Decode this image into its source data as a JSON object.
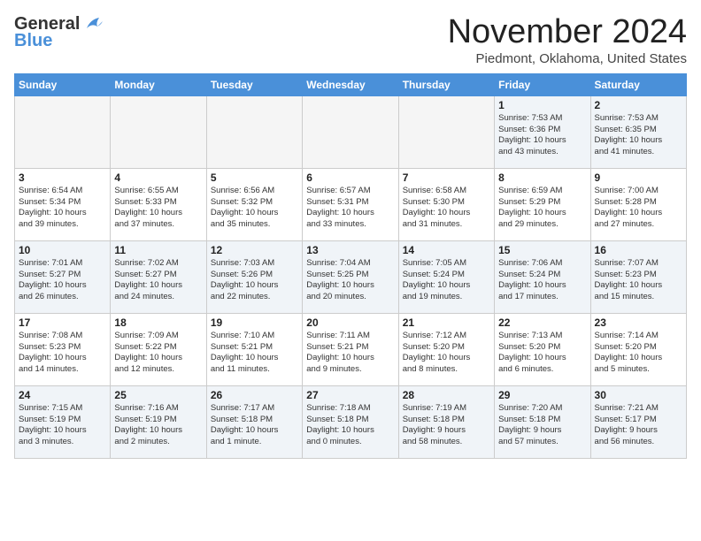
{
  "header": {
    "logo_line1": "General",
    "logo_line2": "Blue",
    "month": "November 2024",
    "location": "Piedmont, Oklahoma, United States"
  },
  "weekdays": [
    "Sunday",
    "Monday",
    "Tuesday",
    "Wednesday",
    "Thursday",
    "Friday",
    "Saturday"
  ],
  "weeks": [
    [
      {
        "day": "",
        "info": ""
      },
      {
        "day": "",
        "info": ""
      },
      {
        "day": "",
        "info": ""
      },
      {
        "day": "",
        "info": ""
      },
      {
        "day": "",
        "info": ""
      },
      {
        "day": "1",
        "info": "Sunrise: 7:53 AM\nSunset: 6:36 PM\nDaylight: 10 hours\nand 43 minutes."
      },
      {
        "day": "2",
        "info": "Sunrise: 7:53 AM\nSunset: 6:35 PM\nDaylight: 10 hours\nand 41 minutes."
      }
    ],
    [
      {
        "day": "3",
        "info": "Sunrise: 6:54 AM\nSunset: 5:34 PM\nDaylight: 10 hours\nand 39 minutes."
      },
      {
        "day": "4",
        "info": "Sunrise: 6:55 AM\nSunset: 5:33 PM\nDaylight: 10 hours\nand 37 minutes."
      },
      {
        "day": "5",
        "info": "Sunrise: 6:56 AM\nSunset: 5:32 PM\nDaylight: 10 hours\nand 35 minutes."
      },
      {
        "day": "6",
        "info": "Sunrise: 6:57 AM\nSunset: 5:31 PM\nDaylight: 10 hours\nand 33 minutes."
      },
      {
        "day": "7",
        "info": "Sunrise: 6:58 AM\nSunset: 5:30 PM\nDaylight: 10 hours\nand 31 minutes."
      },
      {
        "day": "8",
        "info": "Sunrise: 6:59 AM\nSunset: 5:29 PM\nDaylight: 10 hours\nand 29 minutes."
      },
      {
        "day": "9",
        "info": "Sunrise: 7:00 AM\nSunset: 5:28 PM\nDaylight: 10 hours\nand 27 minutes."
      }
    ],
    [
      {
        "day": "10",
        "info": "Sunrise: 7:01 AM\nSunset: 5:27 PM\nDaylight: 10 hours\nand 26 minutes."
      },
      {
        "day": "11",
        "info": "Sunrise: 7:02 AM\nSunset: 5:27 PM\nDaylight: 10 hours\nand 24 minutes."
      },
      {
        "day": "12",
        "info": "Sunrise: 7:03 AM\nSunset: 5:26 PM\nDaylight: 10 hours\nand 22 minutes."
      },
      {
        "day": "13",
        "info": "Sunrise: 7:04 AM\nSunset: 5:25 PM\nDaylight: 10 hours\nand 20 minutes."
      },
      {
        "day": "14",
        "info": "Sunrise: 7:05 AM\nSunset: 5:24 PM\nDaylight: 10 hours\nand 19 minutes."
      },
      {
        "day": "15",
        "info": "Sunrise: 7:06 AM\nSunset: 5:24 PM\nDaylight: 10 hours\nand 17 minutes."
      },
      {
        "day": "16",
        "info": "Sunrise: 7:07 AM\nSunset: 5:23 PM\nDaylight: 10 hours\nand 15 minutes."
      }
    ],
    [
      {
        "day": "17",
        "info": "Sunrise: 7:08 AM\nSunset: 5:23 PM\nDaylight: 10 hours\nand 14 minutes."
      },
      {
        "day": "18",
        "info": "Sunrise: 7:09 AM\nSunset: 5:22 PM\nDaylight: 10 hours\nand 12 minutes."
      },
      {
        "day": "19",
        "info": "Sunrise: 7:10 AM\nSunset: 5:21 PM\nDaylight: 10 hours\nand 11 minutes."
      },
      {
        "day": "20",
        "info": "Sunrise: 7:11 AM\nSunset: 5:21 PM\nDaylight: 10 hours\nand 9 minutes."
      },
      {
        "day": "21",
        "info": "Sunrise: 7:12 AM\nSunset: 5:20 PM\nDaylight: 10 hours\nand 8 minutes."
      },
      {
        "day": "22",
        "info": "Sunrise: 7:13 AM\nSunset: 5:20 PM\nDaylight: 10 hours\nand 6 minutes."
      },
      {
        "day": "23",
        "info": "Sunrise: 7:14 AM\nSunset: 5:20 PM\nDaylight: 10 hours\nand 5 minutes."
      }
    ],
    [
      {
        "day": "24",
        "info": "Sunrise: 7:15 AM\nSunset: 5:19 PM\nDaylight: 10 hours\nand 3 minutes."
      },
      {
        "day": "25",
        "info": "Sunrise: 7:16 AM\nSunset: 5:19 PM\nDaylight: 10 hours\nand 2 minutes."
      },
      {
        "day": "26",
        "info": "Sunrise: 7:17 AM\nSunset: 5:18 PM\nDaylight: 10 hours\nand 1 minute."
      },
      {
        "day": "27",
        "info": "Sunrise: 7:18 AM\nSunset: 5:18 PM\nDaylight: 10 hours\nand 0 minutes."
      },
      {
        "day": "28",
        "info": "Sunrise: 7:19 AM\nSunset: 5:18 PM\nDaylight: 9 hours\nand 58 minutes."
      },
      {
        "day": "29",
        "info": "Sunrise: 7:20 AM\nSunset: 5:18 PM\nDaylight: 9 hours\nand 57 minutes."
      },
      {
        "day": "30",
        "info": "Sunrise: 7:21 AM\nSunset: 5:17 PM\nDaylight: 9 hours\nand 56 minutes."
      }
    ]
  ]
}
